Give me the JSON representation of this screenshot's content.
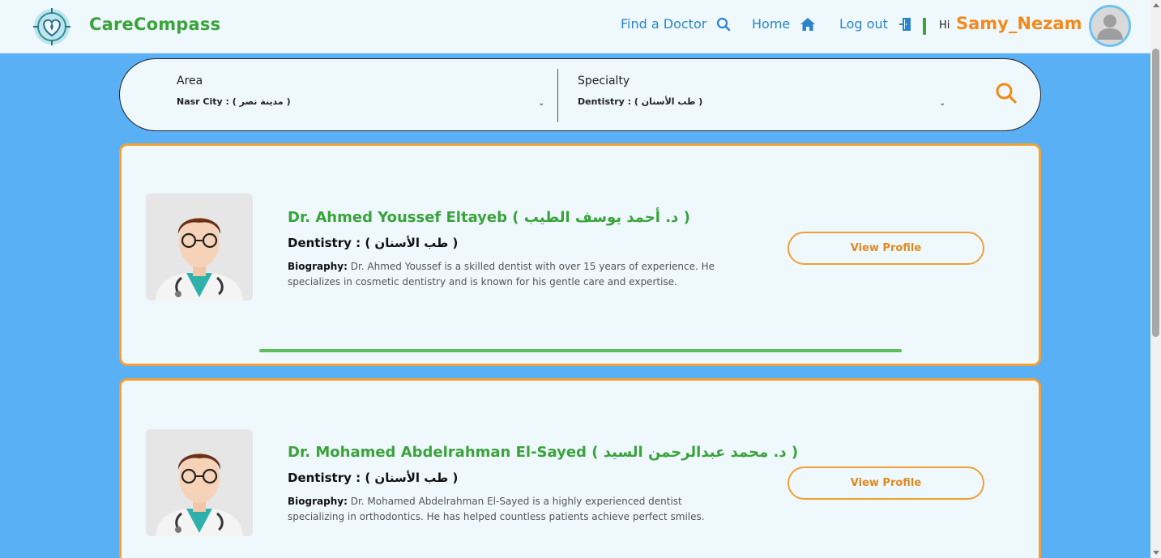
{
  "app": {
    "brand": "CareCompass",
    "greeting": "Hi",
    "username": "Samy_Nezam"
  },
  "nav": {
    "find_doctor": "Find a Doctor",
    "home": "Home",
    "logout": "Log out"
  },
  "search": {
    "area_label": "Area",
    "area_value": "Nasr City : ( مدينة نصر )",
    "specialty_label": "Specialty",
    "specialty_value": "Dentistry : ( طب الأسنان )"
  },
  "doctors": [
    {
      "name": "Dr. Ahmed Youssef Eltayeb ( د. أحمد يوسف الطيب )",
      "specialty": "Dentistry : ( طب الأسنان )",
      "bio_label": "Biography:",
      "bio": "Dr. Ahmed Youssef is a skilled dentist with over 15 years of experience. He specializes in cosmetic dentistry and is known for his gentle care and expertise.",
      "button": "View Profile",
      "progress": 1.0
    },
    {
      "name": "Dr. Mohamed Abdelrahman El-Sayed ( د. محمد عبدالرحمن السيد )",
      "specialty": "Dentistry : ( طب الأسنان )",
      "bio_label": "Biography:",
      "bio": "Dr. Mohamed Abdelrahman El-Sayed is a highly experienced dentist specializing in orthodontics. He has helped countless patients achieve perfect smiles.",
      "button": "View Profile"
    }
  ],
  "colors": {
    "brand_green": "#3aa33a",
    "accent_orange": "#f28a1c",
    "nav_blue": "#2c84c8",
    "page_bg": "#5ab0f5",
    "card_bg": "#eef8fd"
  },
  "icons": {
    "logo": "heart-compass-logo",
    "find": "search-icon",
    "home": "home-icon",
    "logout": "door-exit-icon",
    "avatar": "user-avatar-icon",
    "search_button": "search-icon"
  }
}
